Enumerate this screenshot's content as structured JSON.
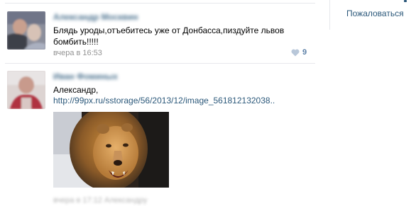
{
  "sidebar": {
    "report_label": "Пожаловаться"
  },
  "comments": [
    {
      "author": "Александр Москвин",
      "text_line1": "Блядь уроды,отъебитесь уже от Донбасса,пиздуйте львов",
      "text_line2": "бомбить!!!!!",
      "time": "вчера в 16:53",
      "likes": "9"
    },
    {
      "author": "Иван Фоминых",
      "text": "Александр,",
      "link": "http://99px.ru/sstorage/56/2013/12/image_561812132038..",
      "time": "вчера в 17:12 Александру"
    }
  ],
  "colors": {
    "link": "#2b587a",
    "meta": "#939393",
    "separator": "#e7e8ec"
  }
}
